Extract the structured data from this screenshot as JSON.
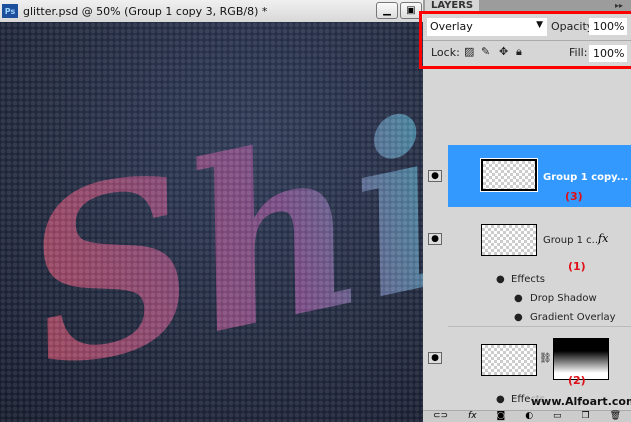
{
  "document": {
    "app_icon": "Ps",
    "title": "glitter.psd @ 50% (Group 1 copy 3, RGB/8) *",
    "canvas_text": "Shin"
  },
  "panel": {
    "tab": "LAYERS",
    "blend_mode": "Overlay",
    "opacity_label": "Opacity:",
    "opacity": "100%",
    "lock_label": "Lock:",
    "fill_label": "Fill:",
    "fill": "100%",
    "layers": [
      {
        "name": "Group 1 copy...",
        "annotation": "(3)",
        "selected": true
      },
      {
        "name": "Group 1 c...",
        "annotation": "(1)",
        "fx": "fx",
        "effects_label": "Effects",
        "effects": [
          "Drop Shadow",
          "Gradient Overlay"
        ]
      },
      {
        "annotation": "(2)",
        "effects_label": "Effects"
      }
    ],
    "bottom_icons": [
      "link-icon",
      "fx-icon",
      "mask-icon",
      "adjustment-icon",
      "folder-icon",
      "new-layer-icon",
      "trash-icon"
    ]
  },
  "watermark": "www.Alfoart.com",
  "colors": {
    "selected": "#3399ff",
    "highlight_box": "#ff0000",
    "annotation": "#e0101a"
  }
}
